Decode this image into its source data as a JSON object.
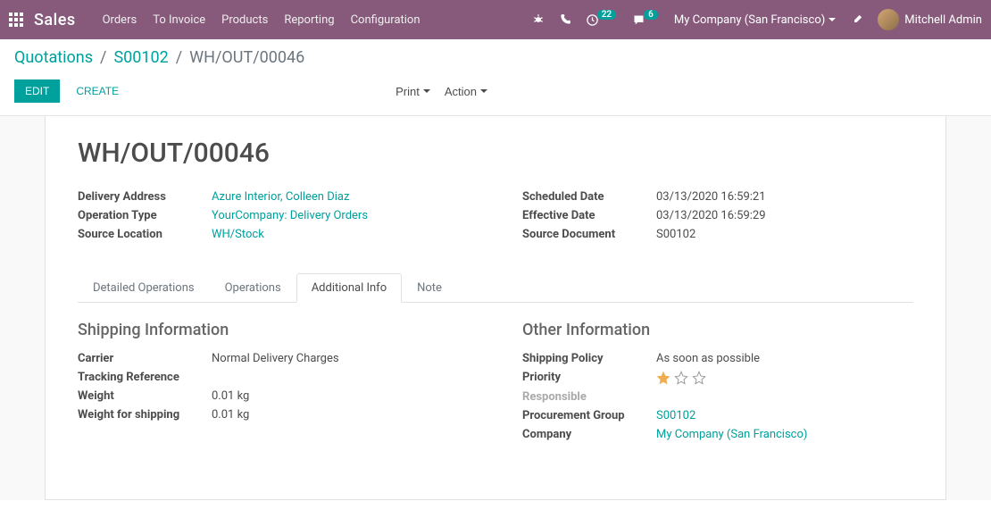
{
  "navbar": {
    "brand": "Sales",
    "menu": [
      "Orders",
      "To Invoice",
      "Products",
      "Reporting",
      "Configuration"
    ],
    "activity_count": "22",
    "msg_count": "6",
    "company": "My Company (San Francisco)",
    "user": "Mitchell Admin"
  },
  "breadcrumb": {
    "items": [
      "Quotations",
      "S00102"
    ],
    "active": "WH/OUT/00046"
  },
  "controls": {
    "edit": "EDIT",
    "create": "CREATE",
    "print": "Print",
    "action": "Action"
  },
  "record": {
    "title": "WH/OUT/00046",
    "left": {
      "delivery_address": {
        "label": "Delivery Address",
        "value": "Azure Interior, Colleen Diaz"
      },
      "operation_type": {
        "label": "Operation Type",
        "value": "YourCompany: Delivery Orders"
      },
      "source_location": {
        "label": "Source Location",
        "value": "WH/Stock"
      }
    },
    "right": {
      "scheduled_date": {
        "label": "Scheduled Date",
        "value": "03/13/2020 16:59:21"
      },
      "effective_date": {
        "label": "Effective Date",
        "value": "03/13/2020 16:59:29"
      },
      "source_document": {
        "label": "Source Document",
        "value": "S00102"
      }
    }
  },
  "tabs": {
    "items": [
      "Detailed Operations",
      "Operations",
      "Additional Info",
      "Note"
    ],
    "active_index": 2
  },
  "additional_info": {
    "shipping": {
      "title": "Shipping Information",
      "carrier": {
        "label": "Carrier",
        "value": "Normal Delivery Charges"
      },
      "tracking": {
        "label": "Tracking Reference",
        "value": ""
      },
      "weight": {
        "label": "Weight",
        "value": "0.01 kg"
      },
      "weight_shipping": {
        "label": "Weight for shipping",
        "value": "0.01 kg"
      }
    },
    "other": {
      "title": "Other Information",
      "shipping_policy": {
        "label": "Shipping Policy",
        "value": "As soon as possible"
      },
      "priority": {
        "label": "Priority",
        "stars": 1,
        "max_stars": 3
      },
      "responsible": {
        "label": "Responsible",
        "value": ""
      },
      "procurement_group": {
        "label": "Procurement Group",
        "value": "S00102"
      },
      "company": {
        "label": "Company",
        "value": "My Company (San Francisco)"
      }
    }
  }
}
